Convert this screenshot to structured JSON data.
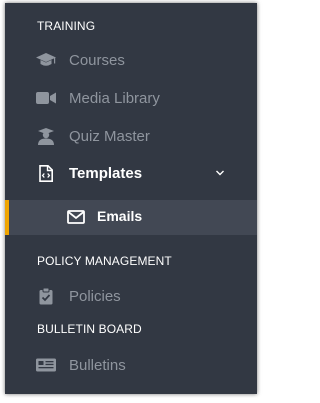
{
  "sections": {
    "training": "TRAINING",
    "policy": "POLICY MANAGEMENT",
    "bulletin": "BULLETIN BOARD"
  },
  "nav": {
    "courses": {
      "label": "Courses",
      "icon": "graduation-cap-icon"
    },
    "media": {
      "label": "Media Library",
      "icon": "video-camera-icon"
    },
    "quiz": {
      "label": "Quiz Master",
      "icon": "student-icon"
    },
    "templates": {
      "label": "Templates",
      "icon": "file-code-icon",
      "expanded": true
    },
    "emails": {
      "label": "Emails",
      "icon": "envelope-icon",
      "active": true
    },
    "policies": {
      "label": "Policies",
      "icon": "clipboard-check-icon"
    },
    "bulletins": {
      "label": "Bulletins",
      "icon": "newspaper-icon"
    }
  },
  "colors": {
    "sidebar_bg": "#323843",
    "active_bg": "#424854",
    "accent": "#f0a500",
    "muted_text": "#8f959e",
    "text": "#ffffff"
  }
}
